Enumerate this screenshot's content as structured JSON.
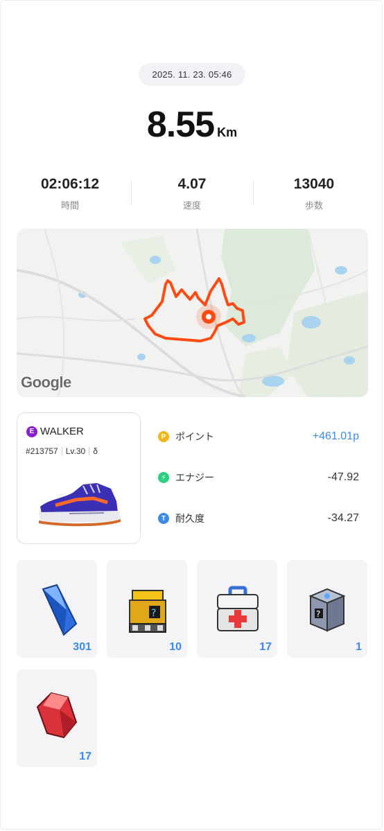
{
  "record": {
    "datetime": "2025. 11. 23. 05:46",
    "distance": "8.55",
    "distance_unit": "Km"
  },
  "stats": [
    {
      "value": "02:06:12",
      "label": "時間"
    },
    {
      "value": "4.07",
      "label": "速度"
    },
    {
      "value": "13040",
      "label": "歩数"
    }
  ],
  "map": {
    "attribution": "Google",
    "route_color": "#ff4a12"
  },
  "nft": {
    "badge": "E",
    "type": "WALKER",
    "id": "#213757",
    "level": "Lv.30",
    "extra_icon": "δ",
    "badge_color": "#8a1fd1"
  },
  "rewards": [
    {
      "icon_letter": "P",
      "icon": "point-icon",
      "label": "ポイント",
      "value": "+461.01p",
      "color": "#f3b516"
    },
    {
      "icon_letter": "⚡",
      "icon": "energy-icon",
      "label": "エナジー",
      "value": "-47.92",
      "color": "#2ccf7f"
    },
    {
      "icon_letter": "T",
      "icon": "durability-icon",
      "label": "耐久度",
      "value": "-34.27",
      "color": "#3a8ae6"
    }
  ],
  "items": [
    {
      "icon": "blue-crystal-icon",
      "count": "301"
    },
    {
      "icon": "yellow-mystery-box-icon",
      "count": "10"
    },
    {
      "icon": "first-aid-kit-icon",
      "count": "17"
    },
    {
      "icon": "silver-mystery-box-icon",
      "count": "1"
    },
    {
      "icon": "red-gem-icon",
      "count": "17"
    }
  ]
}
